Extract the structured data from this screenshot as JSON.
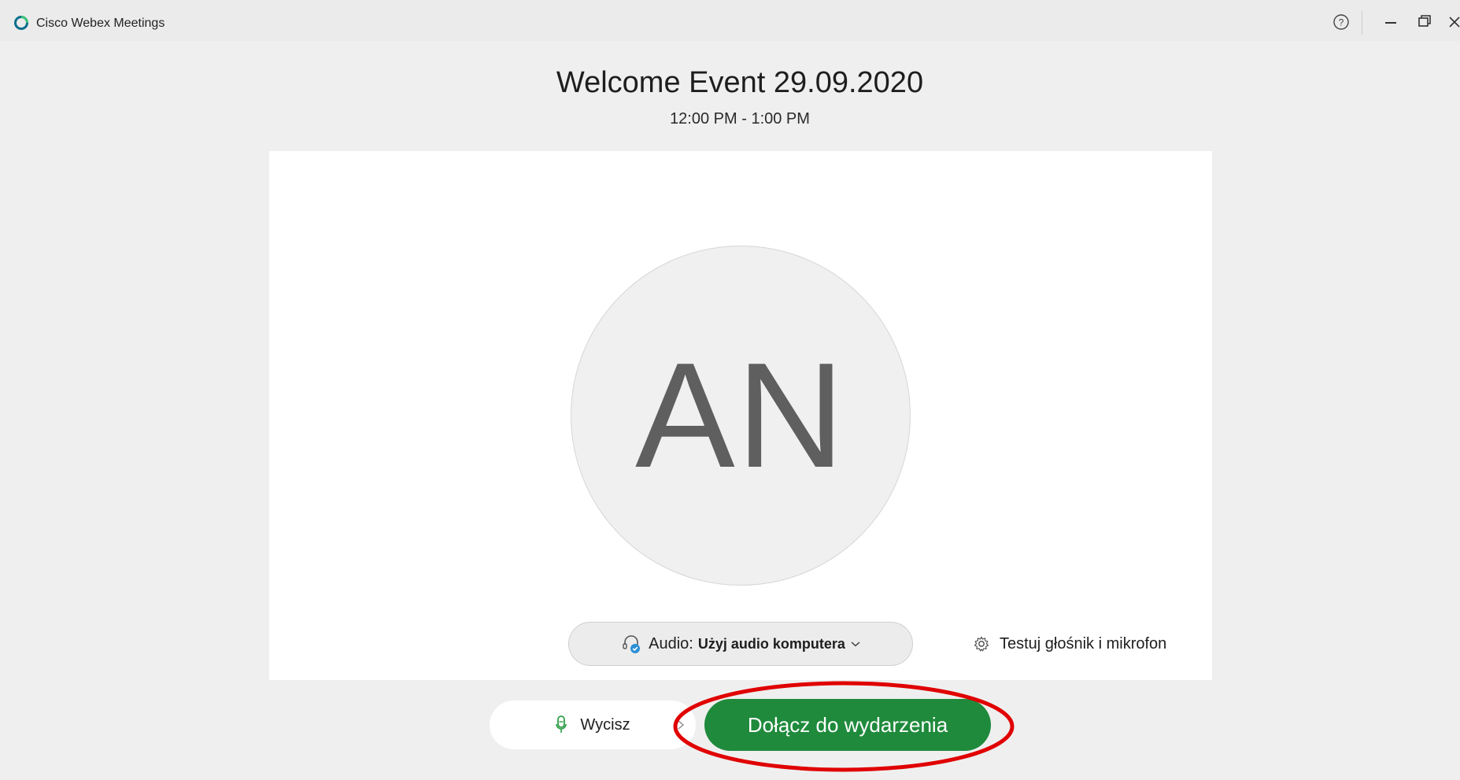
{
  "window": {
    "app_title": "Cisco Webex Meetings"
  },
  "meeting": {
    "title": "Welcome Event 29.09.2020",
    "time": "12:00 PM - 1:00 PM"
  },
  "preview": {
    "avatar_initials": "AN",
    "audio": {
      "prefix": "Audio:",
      "selected": "Użyj audio komputera"
    },
    "test_label": "Testuj głośnik i mikrofon"
  },
  "controls": {
    "mute_label": "Wycisz",
    "join_label": "Dołącz do wydarzenia"
  },
  "colors": {
    "join_button": "#1f8a3c",
    "annotation": "#e00000",
    "mic_icon": "#2e9e47"
  },
  "icons": {
    "app_logo": "webex-logo-icon",
    "help": "help-icon",
    "minimize": "minimize-icon",
    "maximize": "restore-icon",
    "close": "close-icon",
    "audio": "headset-icon",
    "chevron": "chevron-down-icon",
    "test": "gear-icon",
    "mic": "microphone-icon"
  }
}
